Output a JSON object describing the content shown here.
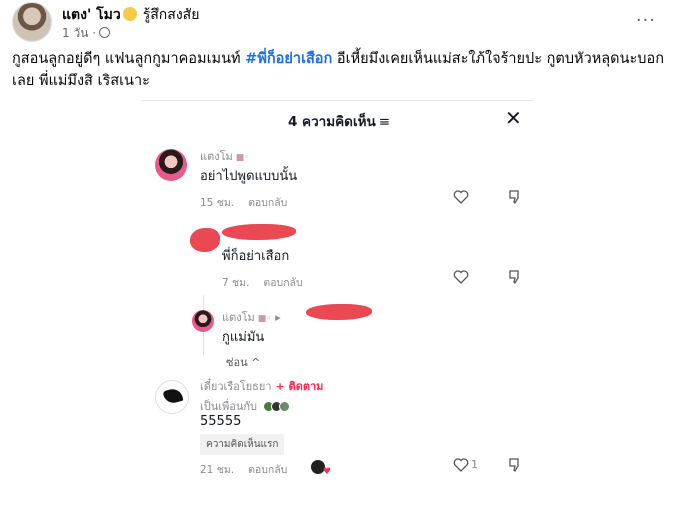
{
  "post": {
    "author": "แตง' โมว",
    "feeling": "รู้สึกสงสัย",
    "time": "1 วัน ·",
    "text_before": "กูสอนลูกอยู่ดีๆ แฟนลูกกูมาคอมเมนท์ ",
    "hashtag": "#พี่ก็อย่าเสือก",
    "text_after": " อีเหี้ยมึงเคยเห็นแม่สะใภ้ใจร้ายปะ กูตบหัวหลุดนะบอกเลย พี่แม่มึงสิ เริสเนาะ",
    "more": "···"
  },
  "comments_panel": {
    "title": "4 ความคิดเห็น",
    "filter_glyph": "≡",
    "close_glyph": "✕",
    "comments": [
      {
        "name": "แตงโม",
        "text": "อย่าไปพูดแบบนั้น",
        "time": "15 ชม.",
        "reply": "ตอบกลับ"
      },
      {
        "name": "",
        "text": "พี่ก็อย่าเสือก",
        "time": "7 ชม.",
        "reply": "ตอบกลับ"
      },
      {
        "name": "แตงโม",
        "reply_arrow": "▸",
        "text": "กูแม่มัน"
      },
      {
        "hide": "ซ่อน ^"
      },
      {
        "name": "เดี๋ยวเรือโยธยา",
        "follow": "+ ติดตาม",
        "friends": "เป็นเพื่อนกับ",
        "text": "55555",
        "badge": "ความคิดเห็นแรก",
        "time": "21 ชม.",
        "reply": "ตอบกลับ",
        "likes": "1"
      }
    ]
  },
  "colors": {
    "hashtag": "#216fdb",
    "follow": "#fe2c55",
    "redaction": "#e8343f"
  }
}
